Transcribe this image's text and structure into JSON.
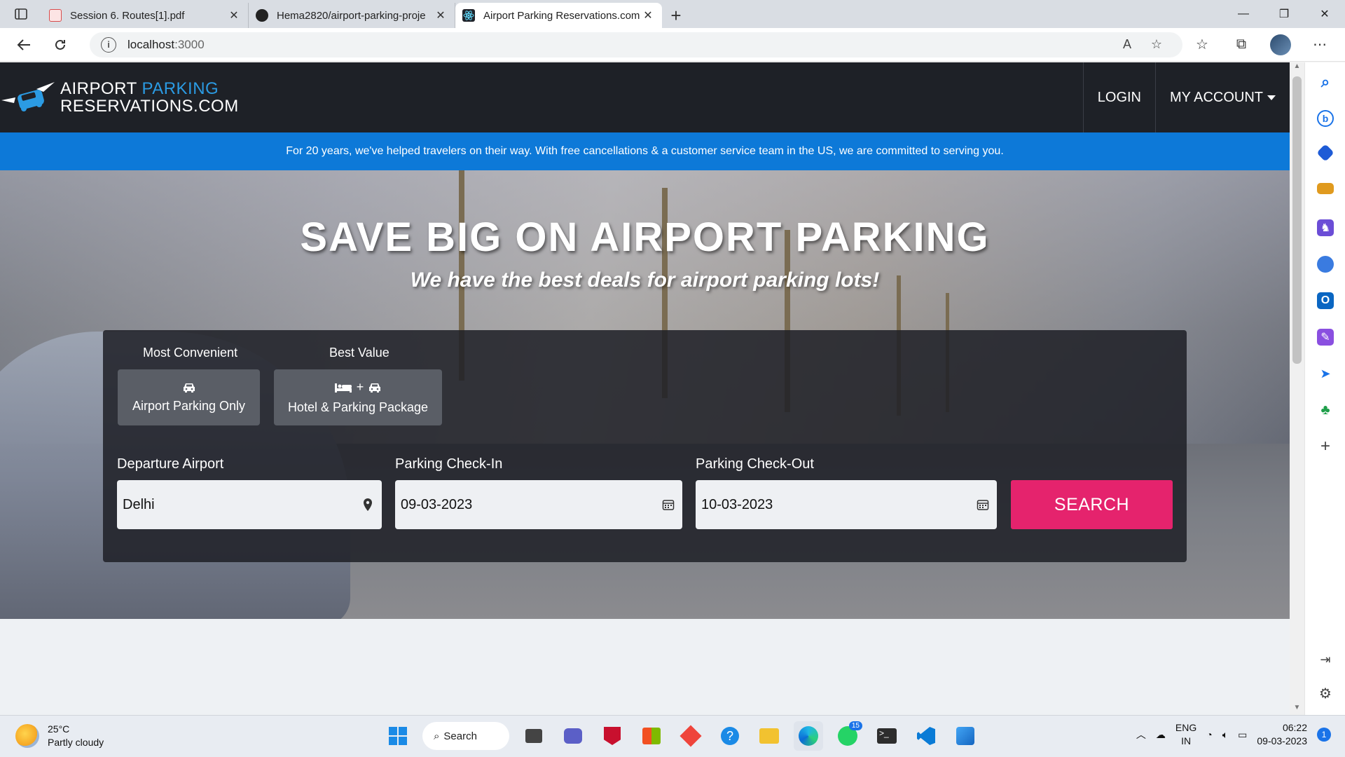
{
  "browser": {
    "tabs": [
      {
        "title": "Session 6. Routes[1].pdf",
        "active": false
      },
      {
        "title": "Hema2820/airport-parking-proje",
        "active": false
      },
      {
        "title": "Airport Parking Reservations.com",
        "active": true
      }
    ],
    "url_host": "localhost",
    "url_port": ":3000"
  },
  "site": {
    "logo_line1_a": "AIRPORT ",
    "logo_line1_b": "PARKING",
    "logo_line2": "RESERVATIONS.COM",
    "nav": {
      "login": "LOGIN",
      "account": "MY ACCOUNT"
    },
    "banner": "For 20 years, we've helped travelers on their way. With free cancellations & a customer service team in the US, we are committed to serving you."
  },
  "hero": {
    "title": "SAVE BIG ON AIRPORT PARKING",
    "subtitle": "We have the best deals for airport parking lots!"
  },
  "search": {
    "option1": {
      "label": "Most Convenient",
      "button": "Airport Parking Only"
    },
    "option2": {
      "label": "Best Value",
      "button": "Hotel & Parking Package",
      "plus": "+"
    },
    "departure": {
      "label": "Departure Airport",
      "value": "Delhi"
    },
    "checkin": {
      "label": "Parking Check-In",
      "value": "09-03-2023"
    },
    "checkout": {
      "label": "Parking Check-Out",
      "value": "10-03-2023"
    },
    "button": "SEARCH"
  },
  "taskbar": {
    "temp": "25°C",
    "weather": "Partly cloudy",
    "search": "Search",
    "whatsapp_badge": "15",
    "lang1": "ENG",
    "lang2": "IN",
    "time": "06:22",
    "date": "09-03-2023",
    "notifications": "1"
  },
  "colors": {
    "accent_pink": "#e5236d",
    "banner_blue": "#0d79d8",
    "navbar": "#1e2127",
    "logo_blue": "#2b9be3"
  }
}
